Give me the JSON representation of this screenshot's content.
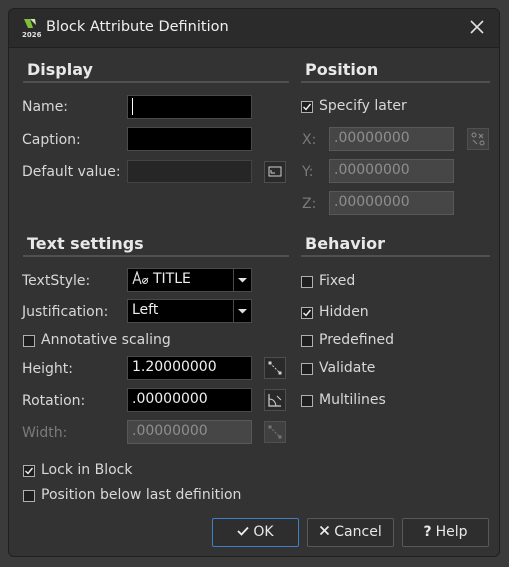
{
  "window": {
    "title": "Block Attribute Definition",
    "app_year": "2026"
  },
  "display": {
    "heading": "Display",
    "name_label": "Name:",
    "name_value": "",
    "caption_label": "Caption:",
    "caption_value": "",
    "default_label": "Default value:",
    "default_value": ""
  },
  "position": {
    "heading": "Position",
    "specify_later_label": "Specify later",
    "specify_later_checked": true,
    "x_label": "X:",
    "x_value": ".00000000",
    "y_label": "Y:",
    "y_value": ".00000000",
    "z_label": "Z:",
    "z_value": ".00000000"
  },
  "text_settings": {
    "heading": "Text settings",
    "textstyle_label": "TextStyle:",
    "textstyle_value": "TITLE",
    "justification_label": "Justification:",
    "justification_value": "Left",
    "annotative_label": "Annotative scaling",
    "annotative_checked": false,
    "height_label": "Height:",
    "height_value": "1.20000000",
    "rotation_label": "Rotation:",
    "rotation_value": ".00000000",
    "width_label": "Width:",
    "width_value": ".00000000"
  },
  "behavior": {
    "heading": "Behavior",
    "items": [
      {
        "label": "Fixed",
        "checked": false
      },
      {
        "label": "Hidden",
        "checked": true
      },
      {
        "label": "Predefined",
        "checked": false
      },
      {
        "label": "Validate",
        "checked": false
      },
      {
        "label": "Multilines",
        "checked": false
      }
    ]
  },
  "options": {
    "lock_label": "Lock in Block",
    "lock_checked": true,
    "below_label": "Position below last definition",
    "below_checked": false
  },
  "buttons": {
    "ok": "OK",
    "cancel": "Cancel",
    "help": "Help"
  }
}
